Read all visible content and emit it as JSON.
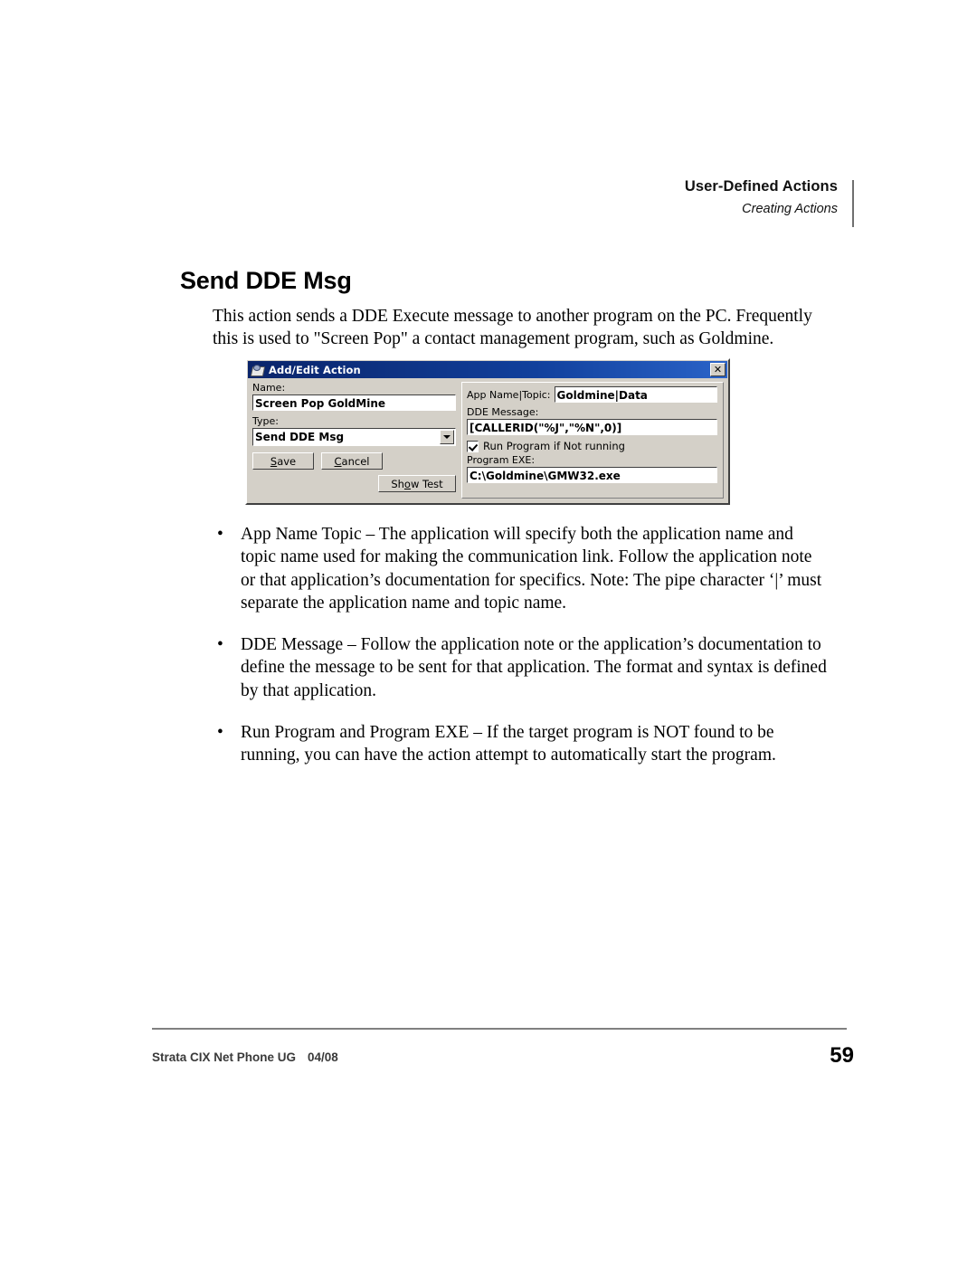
{
  "header": {
    "title": "User-Defined Actions",
    "subtitle": "Creating Actions"
  },
  "heading": "Send DDE Msg",
  "intro": "This action sends a DDE Execute message to another program on the PC.  Frequently this is used to \"Screen Pop\" a contact management program, such as Goldmine.",
  "dialog": {
    "title": "Add/Edit Action",
    "close_label": "✕",
    "name_label": "Name:",
    "name_value": "Screen Pop GoldMine",
    "type_label": "Type:",
    "type_value": "Send DDE Msg",
    "save_label": "Save",
    "save_accel": "S",
    "save_rest": "ave",
    "cancel_accel": "C",
    "cancel_rest": "ancel",
    "showtest_pre": "Sh",
    "showtest_accel": "o",
    "showtest_rest": "w Test",
    "app_name_topic_label": "App Name|Topic:",
    "app_name_topic_value": "Goldmine|Data",
    "dde_message_label": "DDE Message:",
    "dde_message_value": "[CALLERID(\"%J\",\"%N\",0)]",
    "run_program_checkbox_label": "Run Program if Not running",
    "run_program_checked": true,
    "program_exe_label": "Program EXE:",
    "program_exe_value": "C:\\Goldmine\\GMW32.exe"
  },
  "bullets": [
    "App Name Topic – The application will specify both the application name and topic name used for making the communication link.  Follow the application note or that application’s documentation for specifics.  Note: The pipe character ‘|’ must separate the application name and topic name.",
    "DDE Message – Follow the application note or the application’s documentation to define the message to be sent for that application.  The format and syntax is defined by that application.",
    "Run Program and Program EXE – If the target program is NOT found to be running, you can have the action attempt to automatically start the program."
  ],
  "bullet_marker": "•",
  "footer": {
    "doc_title": "Strata CIX Net Phone UG",
    "doc_date": "04/08",
    "page_number": "59"
  },
  "colors": {
    "titlebar_blue": "#0a246a",
    "dialog_face": "#d4d0c8",
    "rule_gray": "#808080"
  }
}
